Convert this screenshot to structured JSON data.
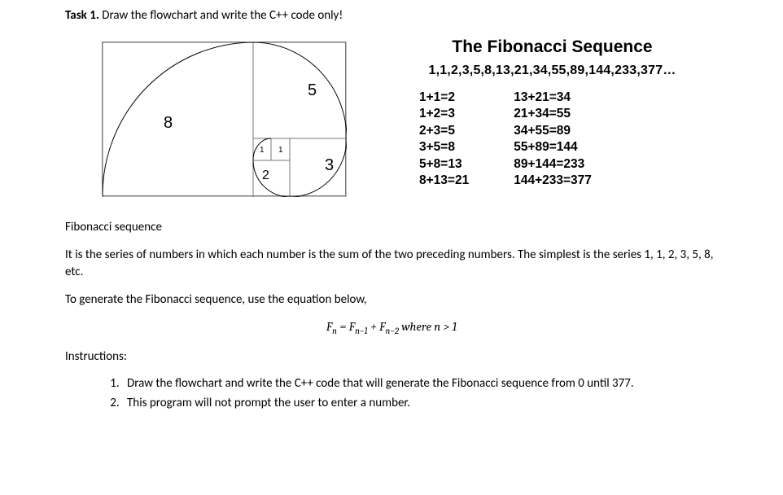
{
  "task": {
    "label": "Task 1.",
    "title": " Draw the flowchart and write the C++ code only!"
  },
  "spiral": {
    "labels": {
      "l8": "8",
      "l5": "5",
      "l3": "3",
      "l2": "2",
      "l1a": "1",
      "l1b": "1"
    }
  },
  "fib": {
    "title": "The Fibonacci Sequence",
    "sequence": "1,1,2,3,5,8,13,21,34,55,89,144,233,377…",
    "col1": [
      "1+1=2",
      "1+2=3",
      "2+3=5",
      "3+5=8",
      "5+8=13",
      "8+13=21"
    ],
    "col2": [
      "13+21=34",
      "21+34=55",
      "34+55=89",
      "55+89=144",
      "89+144=233",
      "144+233=377"
    ]
  },
  "section": {
    "heading": "Fibonacci sequence",
    "p1": "It is the series of numbers in which each number is the sum of the two preceding numbers. The simplest is the series 1, 1, 2, 3, 5, 8, etc.",
    "p2": "To generate the Fibonacci sequence, use the equation below,",
    "eq_where": " where n > 1"
  },
  "instructions": {
    "label": "Instructions:",
    "items": [
      "Draw the flowchart and write the C++ code that will generate the Fibonacci sequence from 0 until 377.",
      "This program will not prompt the user to enter a number."
    ]
  }
}
